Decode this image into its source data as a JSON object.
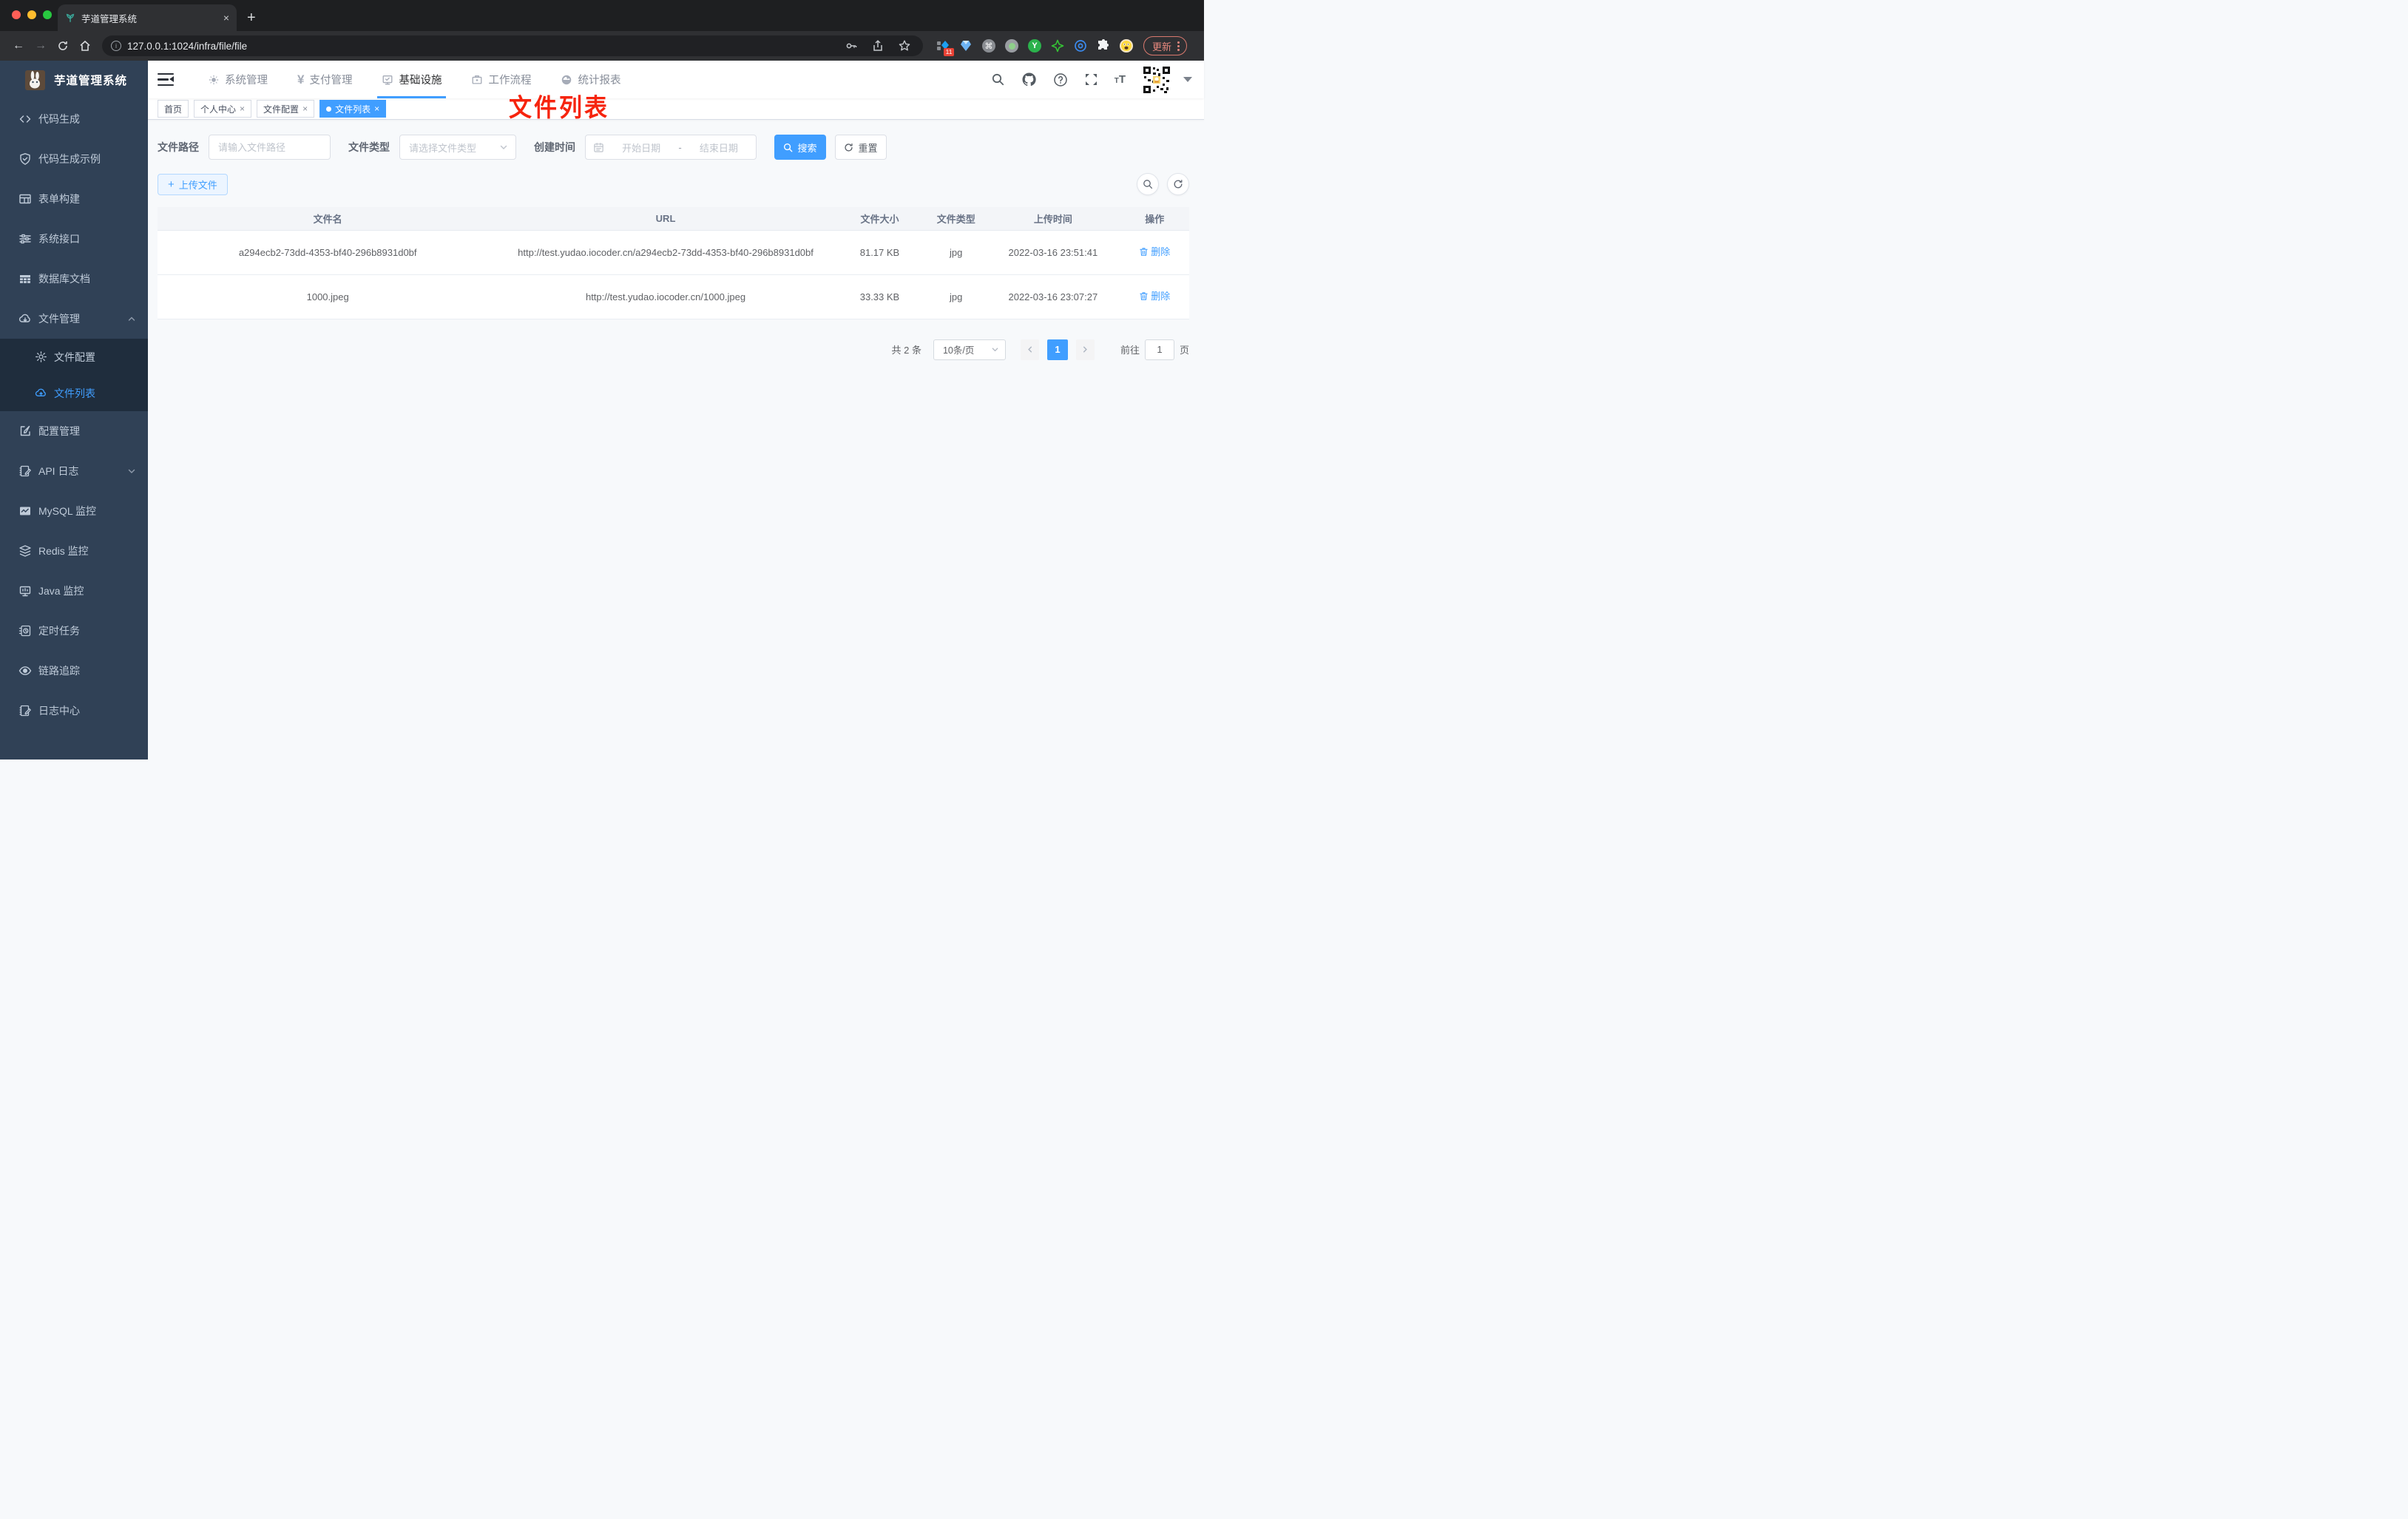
{
  "browser": {
    "tab_title": "芋道管理系统",
    "close_glyph": "×",
    "new_tab_glyph": "+",
    "url": "127.0.0.1:1024/infra/file/file",
    "info_glyph": "i",
    "extension_badge": "11",
    "extension_y": "Y",
    "extension_cmd": "⌘",
    "update_label": "更新"
  },
  "sidebar": {
    "logo_title": "芋道管理系统",
    "items": [
      {
        "label": "代码生成"
      },
      {
        "label": "代码生成示例"
      },
      {
        "label": "表单构建"
      },
      {
        "label": "系统接口"
      },
      {
        "label": "数据库文档"
      },
      {
        "label": "文件管理"
      },
      {
        "label": "文件配置"
      },
      {
        "label": "文件列表"
      },
      {
        "label": "配置管理"
      },
      {
        "label": "API 日志"
      },
      {
        "label": "MySQL 监控"
      },
      {
        "label": "Redis 监控"
      },
      {
        "label": "Java 监控"
      },
      {
        "label": "定时任务"
      },
      {
        "label": "链路追踪"
      },
      {
        "label": "日志中心"
      }
    ]
  },
  "top_nav": {
    "items": [
      {
        "label": "系统管理"
      },
      {
        "label": "支付管理"
      },
      {
        "label": "基础设施",
        "active": true
      },
      {
        "label": "工作流程"
      },
      {
        "label": "统计报表"
      }
    ],
    "yen_glyph": "¥"
  },
  "tags": [
    {
      "label": "首页"
    },
    {
      "label": "个人中心"
    },
    {
      "label": "文件配置"
    },
    {
      "label": "文件列表",
      "active": true
    }
  ],
  "tag_close_glyph": "×",
  "annotation": "文件列表",
  "filters": {
    "path_label": "文件路径",
    "path_placeholder": "请输入文件路径",
    "type_label": "文件类型",
    "type_placeholder": "请选择文件类型",
    "date_label": "创建时间",
    "date_start_placeholder": "开始日期",
    "date_separator": "-",
    "date_end_placeholder": "结束日期",
    "search_label": "搜索",
    "reset_label": "重置"
  },
  "toolbar": {
    "upload_label": "上传文件",
    "plus_glyph": "+"
  },
  "table": {
    "columns": [
      "文件名",
      "URL",
      "文件大小",
      "文件类型",
      "上传时间",
      "操作"
    ],
    "rows": [
      {
        "name": "a294ecb2-73dd-4353-bf40-296b8931d0bf",
        "url": "http://test.yudao.iocoder.cn/a294ecb2-73dd-4353-bf40-296b8931d0bf",
        "size": "81.17 KB",
        "type": "jpg",
        "time": "2022-03-16 23:51:41",
        "action": "删除"
      },
      {
        "name": "1000.jpeg",
        "url": "http://test.yudao.iocoder.cn/1000.jpeg",
        "size": "33.33 KB",
        "type": "jpg",
        "time": "2022-03-16 23:07:27",
        "action": "删除"
      }
    ]
  },
  "pagination": {
    "total_text": "共 2 条",
    "page_size": "10条/页",
    "current_page": "1",
    "goto_label": "前往",
    "goto_value": "1",
    "page_unit": "页"
  },
  "colors": {
    "accent": "#409eff",
    "sidebar_bg": "#304156",
    "submenu_bg": "#1f2d3d",
    "annotation_red": "#f6240e",
    "tag_active_bg": "#409eff"
  }
}
